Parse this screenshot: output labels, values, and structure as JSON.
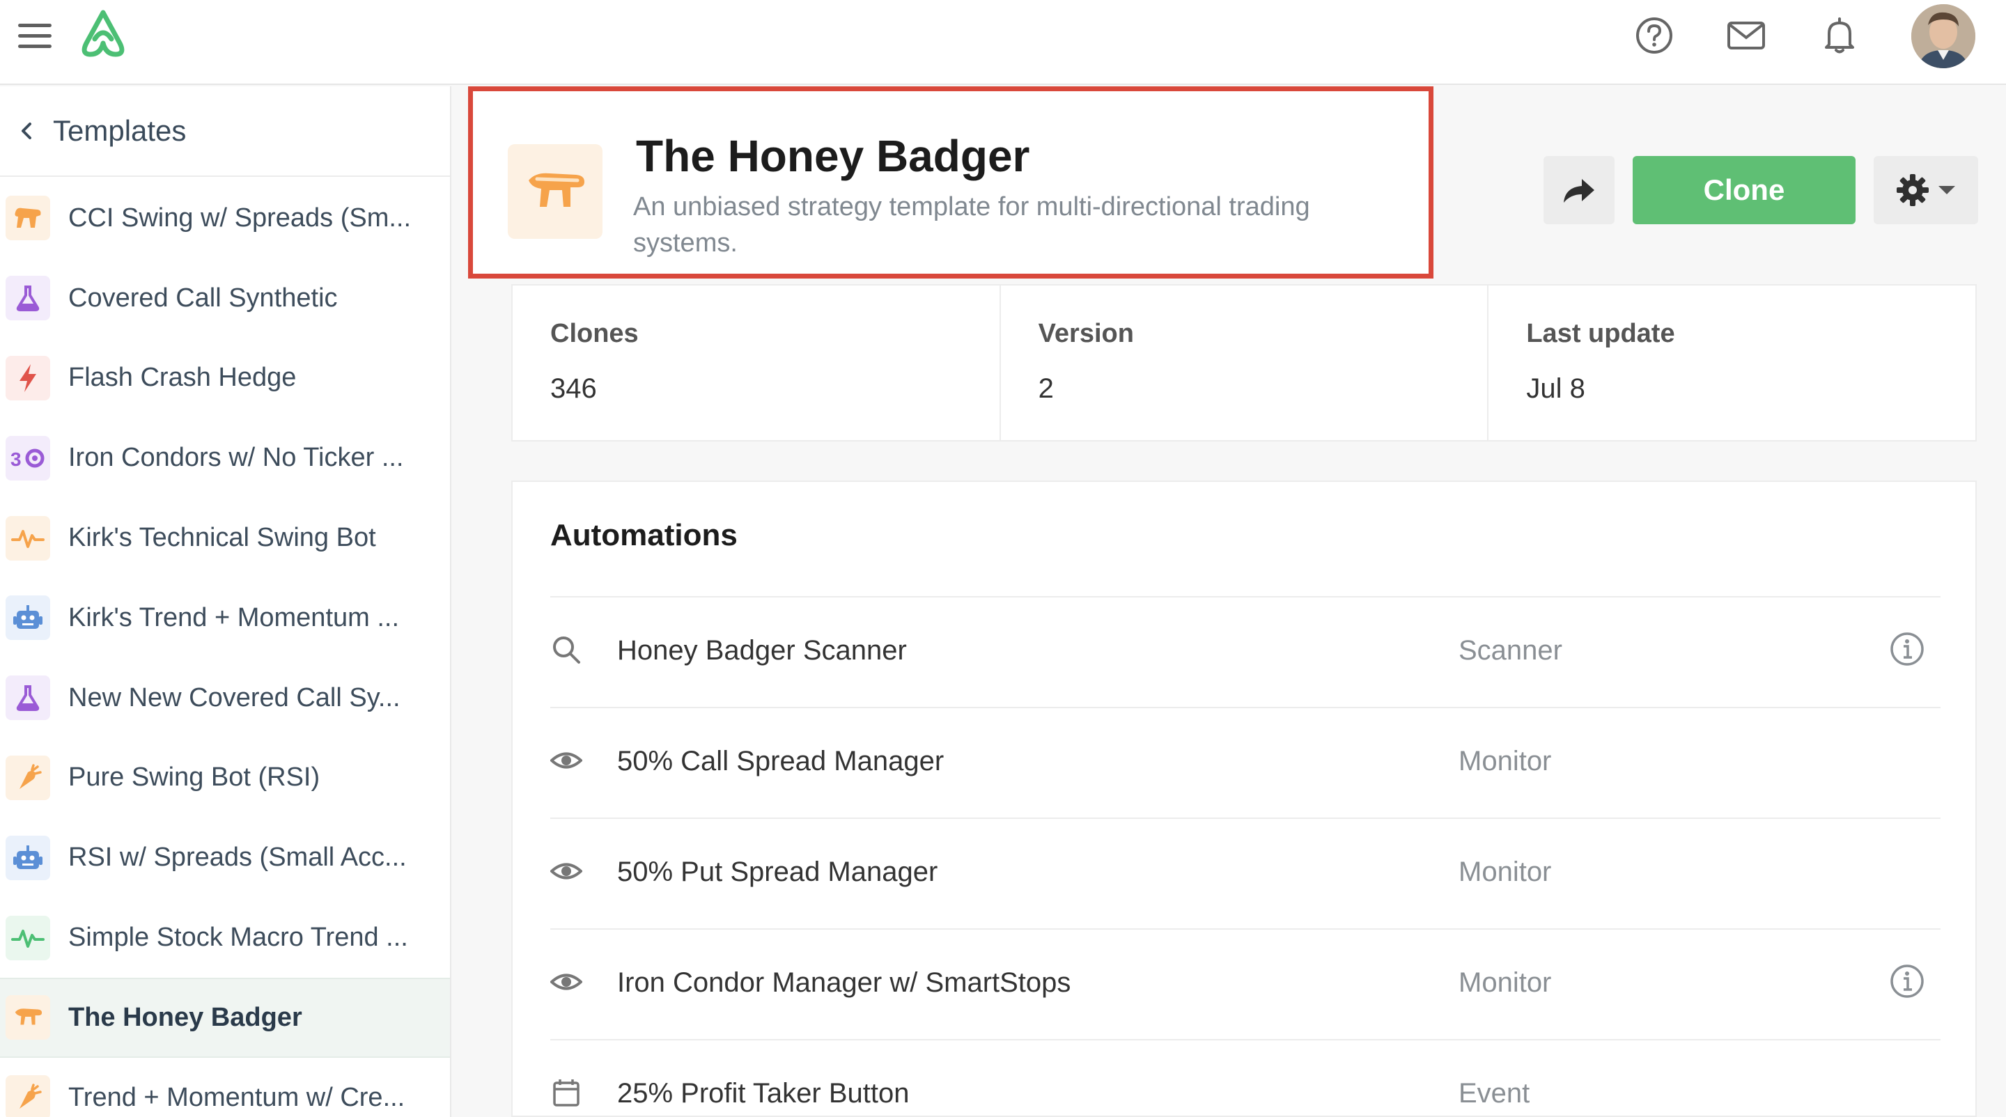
{
  "sidebar": {
    "title": "Templates",
    "items": [
      {
        "label": "CCI Swing w/ Spreads (Sm...",
        "icon": "dog-icon",
        "icon_color": "#f6a34b",
        "bg": "#fdf1e3"
      },
      {
        "label": "Covered Call Synthetic",
        "icon": "flask-icon",
        "icon_color": "#9a5bd6",
        "bg": "#f3ecfb"
      },
      {
        "label": "Flash Crash Hedge",
        "icon": "lightning-icon",
        "icon_color": "#e0534a",
        "bg": "#fdecea"
      },
      {
        "label": "Iron Condors w/ No Ticker ...",
        "icon": "condor-icon",
        "icon_color": "#9a5bd6",
        "bg": "#f3ecfb"
      },
      {
        "label": "Kirk's Technical Swing Bot",
        "icon": "pulse-icon",
        "icon_color": "#f6a34b",
        "bg": "#fdf1e3"
      },
      {
        "label": "Kirk's Trend + Momentum ...",
        "icon": "robot-icon",
        "icon_color": "#5b8fd6",
        "bg": "#eaf1fb"
      },
      {
        "label": "New New Covered Call Sy...",
        "icon": "flask-icon",
        "icon_color": "#9a5bd6",
        "bg": "#f3ecfb"
      },
      {
        "label": "Pure Swing Bot (RSI)",
        "icon": "carrot-icon",
        "icon_color": "#f6a34b",
        "bg": "#fdf1e3"
      },
      {
        "label": "RSI w/ Spreads (Small Acc...",
        "icon": "robot-icon",
        "icon_color": "#5b8fd6",
        "bg": "#eaf1fb"
      },
      {
        "label": "Simple Stock Macro Trend ...",
        "icon": "pulse-icon",
        "icon_color": "#4cbf74",
        "bg": "#eaf7ee"
      },
      {
        "label": "The Honey Badger",
        "icon": "badger-icon",
        "icon_color": "#f6a34b",
        "bg": "#fdf1e3",
        "active": true
      },
      {
        "label": "Trend + Momentum w/ Cre...",
        "icon": "carrot-icon",
        "icon_color": "#f6a34b",
        "bg": "#fdf1e3"
      }
    ]
  },
  "header": {
    "title": "The Honey Badger",
    "description": "An unbiased strategy template for multi-directional trading systems.",
    "clone_label": "Clone"
  },
  "stats": [
    {
      "label": "Clones",
      "value": "346"
    },
    {
      "label": "Version",
      "value": "2"
    },
    {
      "label": "Last update",
      "value": "Jul 8"
    }
  ],
  "automations": {
    "title": "Automations",
    "rows": [
      {
        "name": "Honey Badger Scanner",
        "type": "Scanner",
        "icon": "search-icon",
        "info": true
      },
      {
        "name": "50% Call Spread Manager",
        "type": "Monitor",
        "icon": "eye-icon",
        "info": false
      },
      {
        "name": "50% Put Spread Manager",
        "type": "Monitor",
        "icon": "eye-icon",
        "info": false
      },
      {
        "name": "Iron Condor Manager w/ SmartStops",
        "type": "Monitor",
        "icon": "eye-icon",
        "info": true
      },
      {
        "name": "25% Profit Taker Button",
        "type": "Event",
        "icon": "calendar-icon",
        "info": false
      }
    ]
  },
  "colors": {
    "accent": "#5fbf74",
    "highlight_border": "#d9483b"
  }
}
